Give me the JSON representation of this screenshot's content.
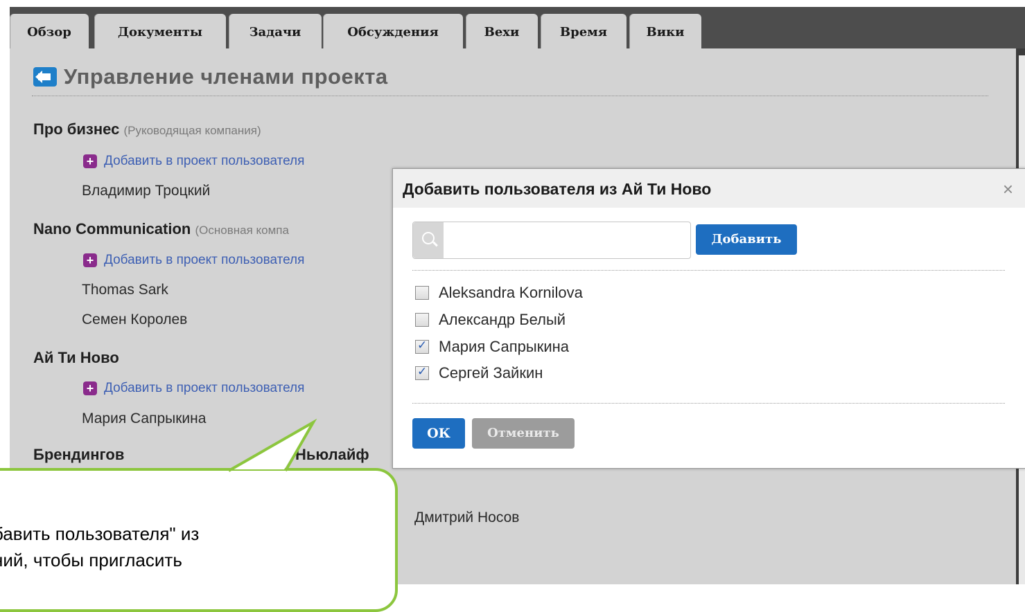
{
  "tabs": [
    {
      "label": "Обзор"
    },
    {
      "label": "Документы"
    },
    {
      "label": "Задачи"
    },
    {
      "label": "Обсуждения"
    },
    {
      "label": "Вехи"
    },
    {
      "label": "Время"
    },
    {
      "label": "Вики"
    }
  ],
  "page": {
    "title": "Управление членами проекта"
  },
  "companies": [
    {
      "name": "Про бизнес",
      "note": "(Руководящая компания)",
      "add_link": "Добавить в проект пользователя",
      "members": [
        "Владимир Троцкий"
      ]
    },
    {
      "name": "Nano Communication",
      "note": "(Основная компа",
      "add_link": "Добавить в проект пользователя",
      "members": [
        "Thomas Sark",
        "Семен Королев"
      ]
    },
    {
      "name": "Ай Ти Ново",
      "note": "",
      "add_link": "Добавить в проект пользователя",
      "members": [
        "Мария Сапрыкина"
      ]
    }
  ],
  "partial_company_left": "Брендингов",
  "partial_company_right": "Ньюлайф",
  "below_dialog_person": "Дмитрий Носов",
  "callout": {
    "line1": "бавить пользователя\" из",
    "line2": "ний, чтобы пригласить"
  },
  "dialog": {
    "title": "Добавить пользователя из Ай Ти Ново",
    "close": "×",
    "search_value": "",
    "add_button": "Добавить",
    "users": [
      {
        "name": "Aleksandra Kornilova",
        "checked": false
      },
      {
        "name": "Александр Белый",
        "checked": false
      },
      {
        "name": "Мария Сапрыкина",
        "checked": true
      },
      {
        "name": "Сергей Зайкин",
        "checked": true
      }
    ],
    "ok_button": "ОК",
    "cancel_button": "Отменить"
  },
  "colors": {
    "accent_blue": "#1e6ec0",
    "link_blue": "#3d5fb3",
    "plus_purple": "#8a2b8c",
    "callout_green": "#8cc63e"
  }
}
